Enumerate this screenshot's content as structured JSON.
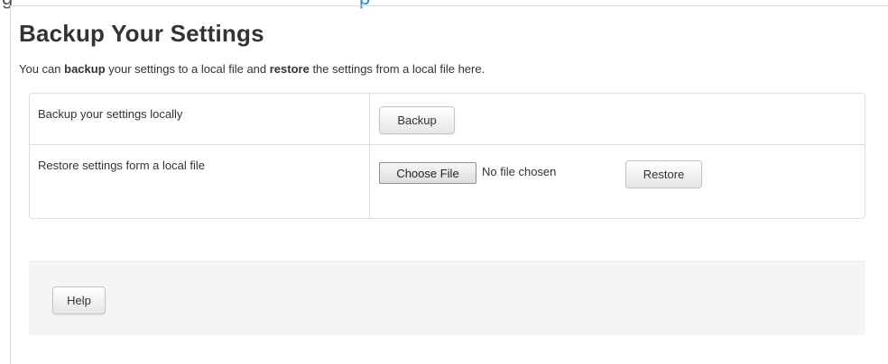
{
  "header": {
    "title": "Backup Your Settings",
    "intro": {
      "part1": "You can ",
      "bold1": "backup",
      "part2": " your settings to a local file and ",
      "bold2": "restore",
      "part3": " the settings from a local file here."
    }
  },
  "table": {
    "rows": [
      {
        "label": "Backup your settings locally",
        "button": "Backup"
      },
      {
        "label": "Restore settings form a local file",
        "choose_file": "Choose File",
        "file_status": "No file chosen",
        "button": "Restore"
      }
    ]
  },
  "footer": {
    "help_label": "Help"
  },
  "colors": {
    "text": "#333333",
    "border": "#dddddd",
    "footer_bg": "#f5f5f5"
  }
}
